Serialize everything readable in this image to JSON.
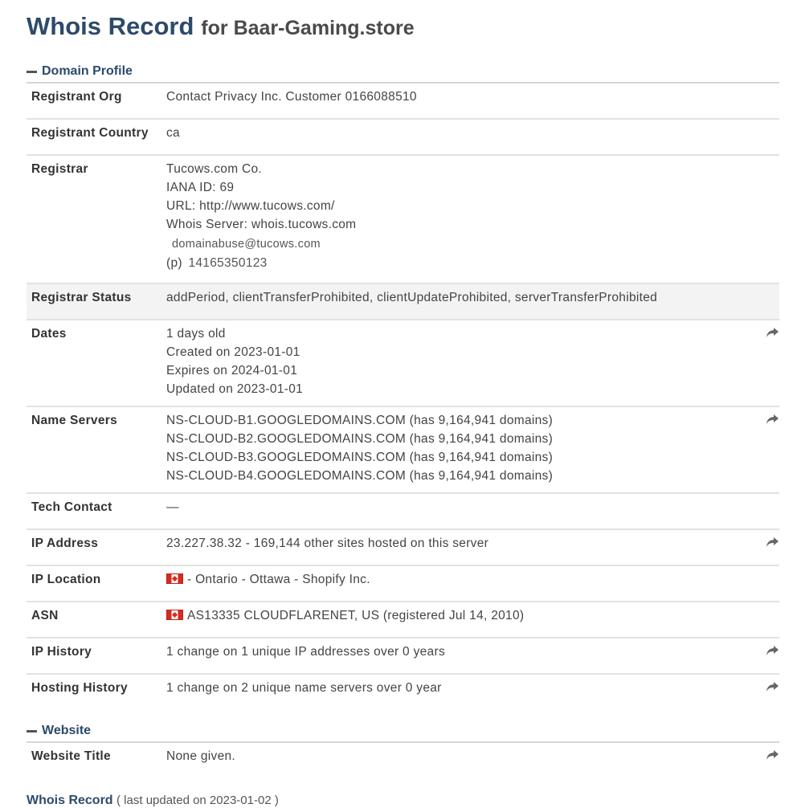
{
  "title": {
    "main": "Whois Record",
    "sub": "for Baar-Gaming.store"
  },
  "sections": {
    "domain_profile": "Domain Profile",
    "website": "Website"
  },
  "profile": {
    "registrant_org": {
      "label": "Registrant Org",
      "value": "Contact Privacy Inc. Customer 0166088510"
    },
    "registrant_country": {
      "label": "Registrant Country",
      "value": "ca"
    },
    "registrar": {
      "label": "Registrar",
      "name": "Tucows.com Co.",
      "iana": "IANA ID: 69",
      "url": "URL: http://www.tucows.com/",
      "whois_server": "Whois Server: whois.tucows.com",
      "email": "domainabuse@tucows.com",
      "phone_label": "(p)",
      "phone": "14165350123"
    },
    "registrar_status": {
      "label": "Registrar Status",
      "value": "addPeriod, clientTransferProhibited, clientUpdateProhibited, serverTransferProhibited"
    },
    "dates": {
      "label": "Dates",
      "age": "1 days old",
      "created": "Created on 2023-01-01",
      "expires": "Expires on 2024-01-01",
      "updated": "Updated on 2023-01-01"
    },
    "name_servers": {
      "label": "Name Servers",
      "items": [
        "NS-CLOUD-B1.GOOGLEDOMAINS.COM (has 9,164,941 domains)",
        "NS-CLOUD-B2.GOOGLEDOMAINS.COM (has 9,164,941 domains)",
        "NS-CLOUD-B3.GOOGLEDOMAINS.COM (has 9,164,941 domains)",
        "NS-CLOUD-B4.GOOGLEDOMAINS.COM (has 9,164,941 domains)"
      ]
    },
    "tech_contact": {
      "label": "Tech Contact",
      "value": "—"
    },
    "ip_address": {
      "label": "IP Address",
      "value": "23.227.38.32 - 169,144 other sites hosted on this server"
    },
    "ip_location": {
      "label": "IP Location",
      "value": "- Ontario - Ottawa - Shopify Inc."
    },
    "asn": {
      "label": "ASN",
      "value": "AS13335 CLOUDFLARENET, US (registered Jul 14, 2010)"
    },
    "ip_history": {
      "label": "IP History",
      "value": "1 change on 1 unique IP addresses over 0 years"
    },
    "hosting_history": {
      "label": "Hosting History",
      "value": "1 change on 2 unique name servers over 0 year"
    }
  },
  "website": {
    "title": {
      "label": "Website Title",
      "value": "None given."
    }
  },
  "footer": {
    "label": "Whois Record",
    "note": "( last updated on 2023-01-02 )"
  },
  "icons": {
    "row_action": "share-arrow-icon",
    "flag": "canada-flag-icon",
    "collapse": "minus-icon"
  },
  "colors": {
    "heading": "#2d4a6b",
    "divider": "#e2e2e2",
    "shaded_row": "#f3f3f3"
  }
}
